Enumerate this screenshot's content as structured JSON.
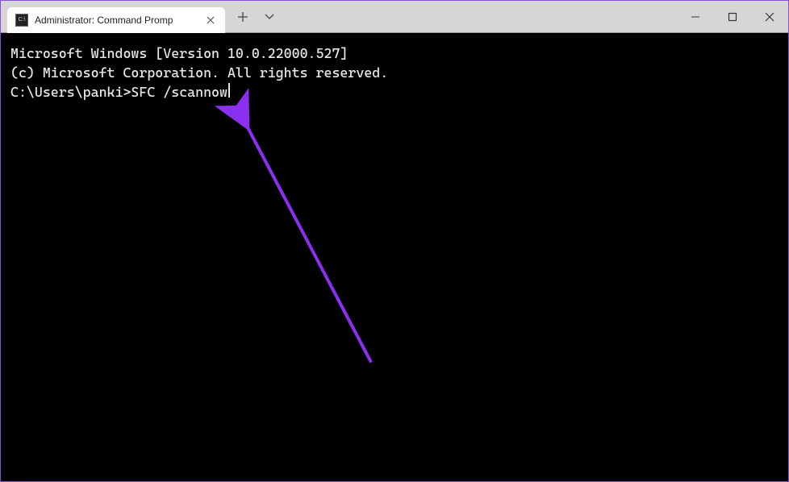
{
  "tab": {
    "title": "Administrator: Command Promp",
    "icon_label": "C:\\"
  },
  "terminal": {
    "line1": "Microsoft Windows [Version 10.0.22000.527]",
    "line2": "(c) Microsoft Corporation. All rights reserved.",
    "blank": "",
    "prompt": "C:\\Users\\panki>",
    "command": "SFC /scannow"
  },
  "annotation": {
    "color": "#8b2ff0"
  }
}
